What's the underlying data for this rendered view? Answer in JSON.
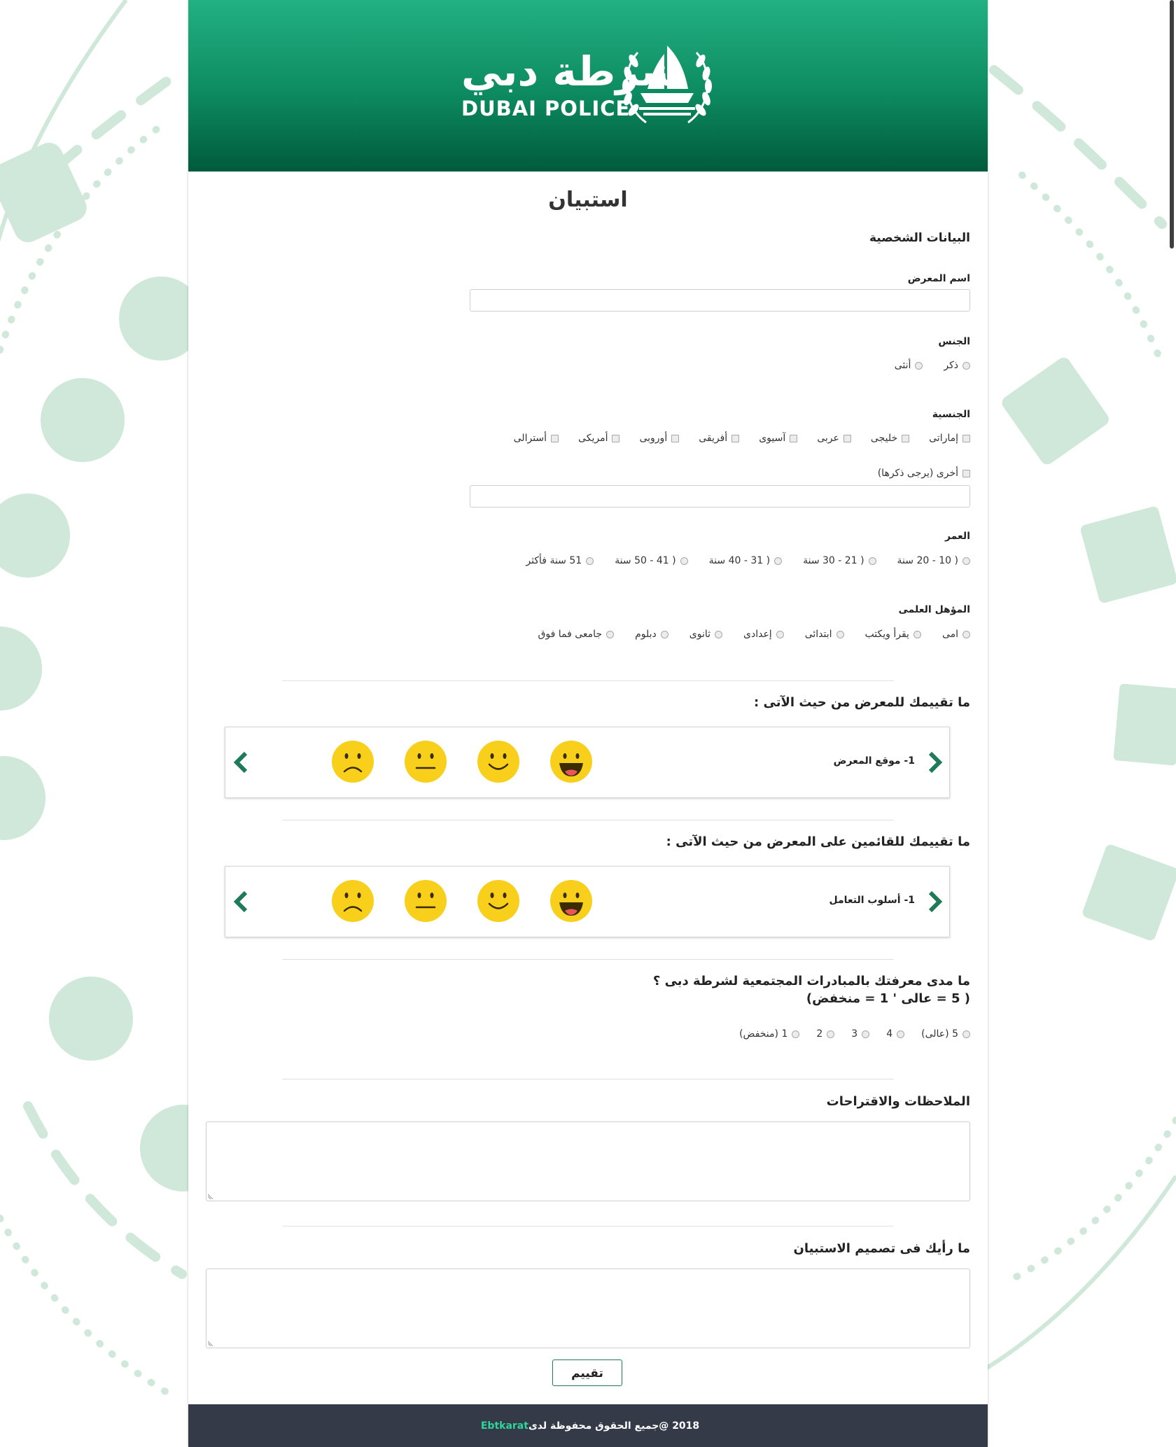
{
  "header": {
    "logo_ar": "شرطة دبي",
    "logo_en": "DUBAI POLICE"
  },
  "page_title": "استبيان",
  "personal": {
    "section_title": "البيانات الشخصية",
    "exhibition_name_label": "اسم المعرض",
    "exhibition_name_value": "",
    "gender_label": "الجنس",
    "gender_options": [
      "ذكر",
      "أنثى"
    ],
    "nationality_label": "الجنسية",
    "nationality_options": [
      "إماراتى",
      "خليجى",
      "عربى",
      "آسيوى",
      "أفريقى",
      "أوروبى",
      "أمريكى",
      "أسترالى"
    ],
    "nationality_other": "أخرى (يرجى ذكرها)",
    "nationality_other_value": "",
    "age_label": "العمر",
    "age_options": [
      "( 10 - 20 سنة",
      "( 21 - 30 سنة",
      "( 31 - 40 سنة",
      "( 41 - 50 سنة",
      "51 سنة فأكثر"
    ],
    "education_label": "المؤهل العلمى",
    "education_options": [
      "امى",
      "يقرأ ويكتب",
      "ابتدائى",
      "إعدادى",
      "ثانوى",
      "دبلوم",
      "جامعى فما فوق"
    ]
  },
  "rating_exhibition": {
    "question": "ما تقييمك للمعرض من حيث الآتى :",
    "item_label": "1- موقع المعرض",
    "faces": [
      "very-happy-face-icon",
      "happy-face-icon",
      "neutral-face-icon",
      "sad-face-icon"
    ]
  },
  "rating_staff": {
    "question": "ما تقييمك للقائمين على المعرض من حيث الآتى :",
    "item_label": "1- أسلوب التعامل",
    "faces": [
      "very-happy-face-icon",
      "happy-face-icon",
      "neutral-face-icon",
      "sad-face-icon"
    ]
  },
  "awareness": {
    "question_line1": "ما مدى معرفتك بالمبادرات المجتمعية لشرطة دبى ؟",
    "question_line2": "( 5 = عالى ' 1 = منخفض)",
    "options": [
      "5 (عالى)",
      "4",
      "3",
      "2",
      "1 (منخفض)"
    ]
  },
  "notes": {
    "label": "الملاحظات والاقتراحات",
    "value": ""
  },
  "design_opinion": {
    "label": "ما رأيك فى تصميم الاستبيان",
    "value": ""
  },
  "submit_label": "تقييم",
  "footer": {
    "copyright": "2018 @جميع الحقوق محفوظة لدى",
    "brand": "Ebtkarat"
  },
  "colors": {
    "header_top": "#22b182",
    "header_bottom": "#005a3c",
    "accent": "#1f7a5a",
    "face_yellow": "#f8cf1a",
    "footer_bg": "#343a48",
    "footer_brand": "#2ed49a",
    "background_deco": "#cfe8da"
  }
}
